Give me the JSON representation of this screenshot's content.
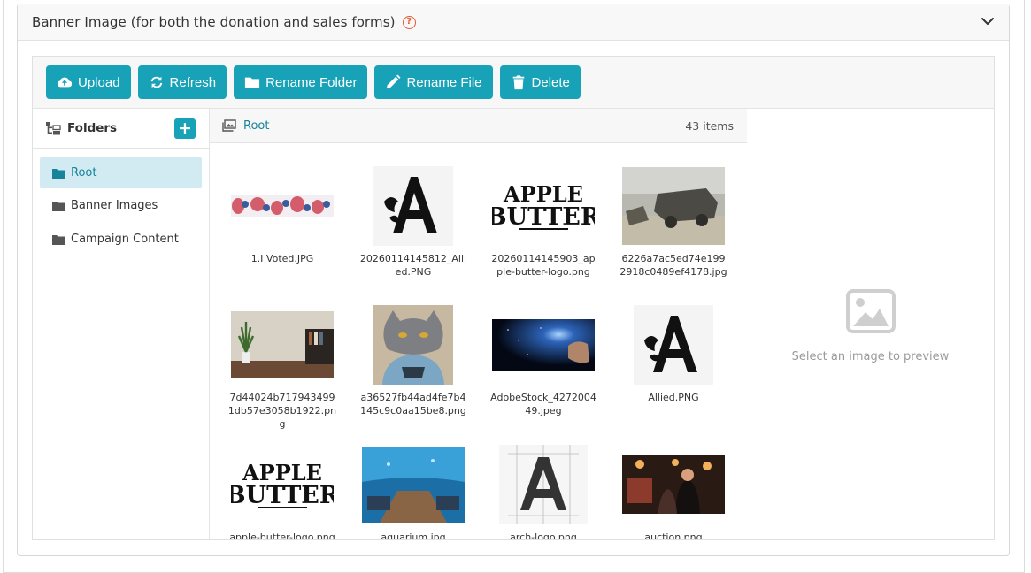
{
  "panel": {
    "title": "Banner Image (for both the donation and sales forms)",
    "help_icon": "question-circle-icon",
    "collapse_icon": "chevron-down-icon"
  },
  "toolbar": {
    "upload_label": "Upload",
    "refresh_label": "Refresh",
    "rename_folder_label": "Rename Folder",
    "rename_file_label": "Rename File",
    "delete_label": "Delete"
  },
  "folders": {
    "title": "Folders",
    "items": [
      {
        "label": "Root",
        "active": true
      },
      {
        "label": "Banner Images",
        "active": false
      },
      {
        "label": "Campaign Content",
        "active": false
      }
    ]
  },
  "files": {
    "breadcrumb": "Root",
    "count": "43 items",
    "items": [
      {
        "name": "1.I Voted.JPG"
      },
      {
        "name": "20260114145812_Allied.PNG"
      },
      {
        "name": "20260114145903_apple-butter-logo.png"
      },
      {
        "name": "6226a7ac5ed74e1992918c0489ef4178.jpg"
      },
      {
        "name": "7d44024b7179434991db57e3058b1922.png"
      },
      {
        "name": "a36527fb44ad4fe7b4145c9c0aa15be8.png"
      },
      {
        "name": "AdobeStock_427200449.jpeg"
      },
      {
        "name": "Allied.PNG"
      },
      {
        "name": "apple-butter-logo.png"
      },
      {
        "name": "aquarium.jpg"
      },
      {
        "name": "arch-logo.png"
      },
      {
        "name": "auction.png"
      }
    ]
  },
  "preview": {
    "empty_text": "Select an image to preview"
  },
  "colors": {
    "accent": "#17a2b8",
    "active_folder_bg": "#d2eaf1",
    "help_icon": "#e8572f"
  }
}
